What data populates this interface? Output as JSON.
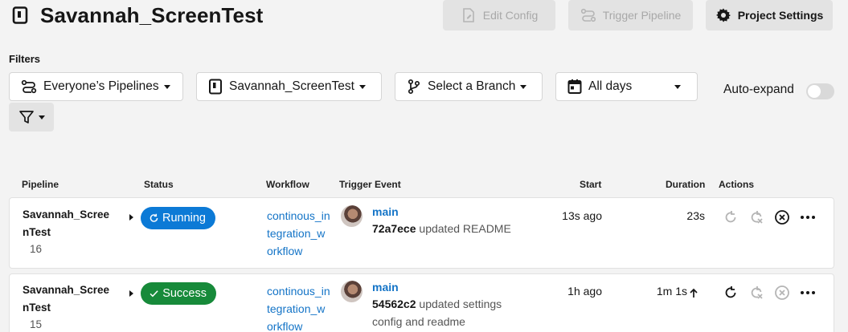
{
  "header": {
    "title": "Savannah_ScreenTest"
  },
  "top_buttons": {
    "edit_config": "Edit Config",
    "trigger_pipeline": "Trigger Pipeline",
    "project_settings": "Project Settings"
  },
  "filters": {
    "label": "Filters",
    "pipelines": "Everyone’s Pipelines",
    "project": "Savannah_ScreenTest",
    "branch": "Select a Branch",
    "days": "All days",
    "auto_expand": "Auto-expand",
    "auto_expand_on": false
  },
  "table": {
    "headers": [
      "Pipeline",
      "Status",
      "Workflow",
      "Trigger Event",
      "Start",
      "Duration",
      "Actions"
    ],
    "rows": [
      {
        "pipeline_name": "Savannah_ScreenTest",
        "pipeline_number": "16",
        "status": "Running",
        "workflow": "continous_integration_workflow",
        "branch": "main",
        "commit_hash": "72a7ece",
        "commit_message": "updated README",
        "start": "13s ago",
        "duration": "23s"
      },
      {
        "pipeline_name": "Savannah_ScreenTest",
        "pipeline_number": "15",
        "status": "Success",
        "workflow": "continous_integration_workflow",
        "branch": "main",
        "commit_hash": "54562c2",
        "commit_message": "updated settings config and readme",
        "start": "1h ago",
        "duration": "1m 1s"
      }
    ]
  },
  "colors": {
    "running": "#0c7ad6",
    "success": "#178a3a",
    "link": "#1474c7"
  }
}
